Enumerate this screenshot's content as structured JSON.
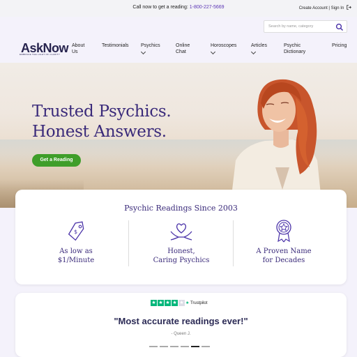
{
  "topbar": {
    "call_text": "Call now to get a reading:",
    "phone": "1-800-227-5669",
    "account_text": "Create Account | Sign In"
  },
  "search": {
    "placeholder": "Search by name, category"
  },
  "logo": {
    "name": "AskNow",
    "tagline": "EMBRACE THE LIGHT OF CLARITY"
  },
  "nav": {
    "items": [
      {
        "label_line1": "About",
        "label_line2": "Us",
        "has_dropdown": false
      },
      {
        "label_line1": "Testimonials",
        "label_line2": "",
        "has_dropdown": false
      },
      {
        "label_line1": "Psychics",
        "label_line2": "",
        "has_dropdown": true
      },
      {
        "label_line1": "Online",
        "label_line2": "Chat",
        "has_dropdown": false
      },
      {
        "label_line1": "Horoscopes",
        "label_line2": "",
        "has_dropdown": true
      },
      {
        "label_line1": "Articles",
        "label_line2": "",
        "has_dropdown": true
      },
      {
        "label_line1": "Psychic",
        "label_line2": "Dictionary",
        "has_dropdown": false
      },
      {
        "label_line1": "Pricing",
        "label_line2": "",
        "has_dropdown": false
      }
    ]
  },
  "hero": {
    "headline_line1": "Trusted Psychics.",
    "headline_line2": "Honest Answers.",
    "cta_label": "Get a Reading"
  },
  "features": {
    "title": "Psychic Readings Since 2003",
    "items": [
      {
        "icon": "price-tag-icon",
        "line1": "As low as",
        "line2": "$1/Minute"
      },
      {
        "icon": "heart-hands-icon",
        "line1": "Honest,",
        "line2": "Caring Psychics"
      },
      {
        "icon": "award-badge-icon",
        "line1": "A Proven Name",
        "line2": "for Decades"
      }
    ]
  },
  "testimonial": {
    "brand": "Trustpilot",
    "rating_stars": 4,
    "quote": "\"Most accurate readings ever!\"",
    "author": "- Queen J.",
    "slide_count": 6,
    "active_slide": 5
  },
  "colors": {
    "brand_purple": "#3a2a7a",
    "cta_green": "#3f9e2a",
    "trustpilot_green": "#00b67a",
    "link_purple": "#5b35b5"
  }
}
